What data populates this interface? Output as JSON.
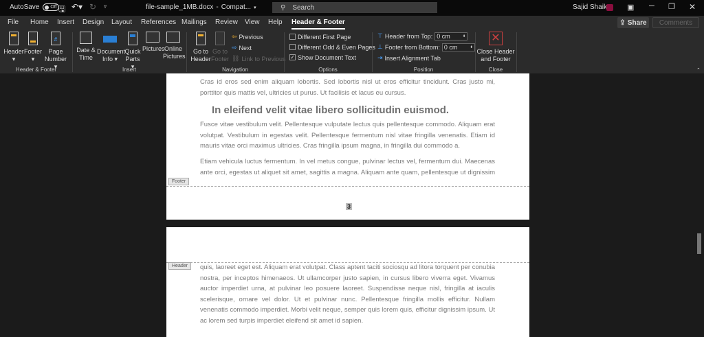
{
  "titlebar": {
    "autosave": "AutoSave",
    "autosave_state": "Off",
    "filename": "file-sample_1MB.docx",
    "mode": "Compat...",
    "search": "Search",
    "user": "Sajid Shaik"
  },
  "tabs": [
    "File",
    "Home",
    "Insert",
    "Design",
    "Layout",
    "References",
    "Mailings",
    "Review",
    "View",
    "Help",
    "Header & Footer"
  ],
  "active_tab": "Header & Footer",
  "share": "Share",
  "comments": "Comments",
  "ribbon": {
    "hf": {
      "header": "Header",
      "footer": "Footer",
      "page1": "Page",
      "page2": "Number",
      "group": "Header & Footer"
    },
    "insert": {
      "date1": "Date &",
      "date2": "Time",
      "doc1": "Document",
      "doc2": "Info",
      "qp1": "Quick",
      "qp2": "Parts",
      "pictures": "Pictures",
      "op1": "Online",
      "op2": "Pictures",
      "group": "Insert"
    },
    "nav": {
      "gh1": "Go to",
      "gh2": "Header",
      "gf1": "Go to",
      "gf2": "Footer",
      "previous": "Previous",
      "next": "Next",
      "link": "Link to Previous",
      "group": "Navigation"
    },
    "options": {
      "first": "Different First Page",
      "odd": "Different Odd & Even Pages",
      "show": "Show Document Text",
      "first_checked": false,
      "odd_checked": false,
      "show_checked": true,
      "group": "Options"
    },
    "position": {
      "htop": "Header from Top:",
      "htop_val": "0 cm",
      "fbot": "Footer from Bottom:",
      "fbot_val": "0 cm",
      "align": "Insert Alignment Tab",
      "group": "Position"
    },
    "close": {
      "l1": "Close Header",
      "l2": "and Footer",
      "group": "Close"
    }
  },
  "page1": {
    "p1": "Cras id eros sed enim aliquam lobortis. Sed lobortis nisl ut eros efficitur tincidunt. Cras justo mi, porttitor quis mattis vel, ultricies ut purus. Ut facilisis et lacus eu cursus.",
    "heading": "In eleifend velit vitae libero sollicitudin euismod.",
    "p2": "Fusce vitae vestibulum velit. Pellentesque vulputate lectus quis pellentesque commodo. Aliquam erat volutpat. Vestibulum in egestas velit. Pellentesque fermentum nisl vitae fringilla venenatis. Etiam id mauris vitae orci maximus ultricies. Cras fringilla ipsum magna, in fringilla dui commodo a.",
    "p3": "Etiam vehicula luctus fermentum. In vel metus congue, pulvinar lectus vel, fermentum dui. Maecenas ante orci, egestas ut aliquet sit amet, sagittis a magna. Aliquam ante quam, pellentesque ut dignissim",
    "footer_tag": "Footer",
    "page_number": "3"
  },
  "page2": {
    "header_tag": "Header",
    "p1": "quis, laoreet eget est. Aliquam erat volutpat. Class aptent taciti sociosqu ad litora torquent per conubia nostra, per inceptos himenaeos. Ut ullamcorper justo sapien, in cursus libero viverra eget. Vivamus auctor imperdiet urna, at pulvinar leo posuere laoreet. Suspendisse neque nisl, fringilla at iaculis scelerisque, ornare vel dolor. Ut et pulvinar nunc. Pellentesque fringilla mollis efficitur. Nullam venenatis commodo imperdiet. Morbi velit neque, semper quis lorem quis, efficitur dignissim ipsum. Ut ac lorem sed turpis imperdiet eleifend sit amet id sapien."
  }
}
